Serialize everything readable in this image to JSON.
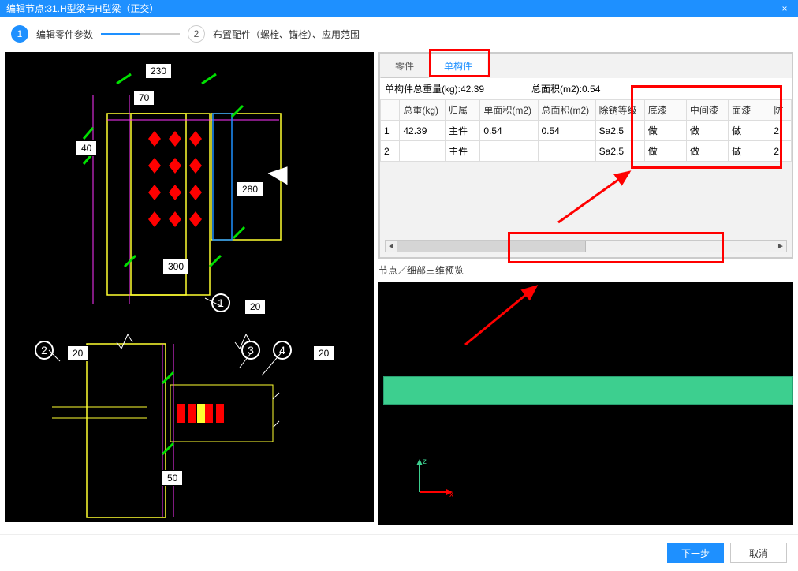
{
  "title": "编辑节点:31.H型梁与H型梁（正交）",
  "close_glyph": "×",
  "steps": {
    "one": "1",
    "one_label": "编辑零件参数",
    "two": "2",
    "two_label": "布置配件（螺栓、锚栓）、应用范围"
  },
  "left": {
    "dim_230": "230",
    "dim_70": "70",
    "dim_40": "40",
    "dim_280": "280",
    "dim_300": "300",
    "dim_20a": "20",
    "dim_20b": "20",
    "dim_20c": "20",
    "dim_50": "50",
    "lbl1": "1",
    "lbl2": "2",
    "lbl3": "3",
    "lbl4": "4"
  },
  "tabs": {
    "part": "零件",
    "single": "单构件"
  },
  "summary": {
    "weight": "单构件总重量(kg):42.39",
    "area": "总面积(m2):0.54"
  },
  "grid": {
    "headers": {
      "idx": "",
      "w": "总重(kg)",
      "belong": "归属",
      "sa": "单面积(m2)",
      "ta": "总面积(m2)",
      "rust": "除锈等级",
      "primer": "底漆",
      "mid": "中间漆",
      "top": "面漆",
      "fire": "防"
    },
    "rows": [
      {
        "idx": "1",
        "w": "42.39",
        "belong": "主件",
        "sa": "0.54",
        "ta": "0.54",
        "rust": "Sa2.5",
        "primer": "做",
        "mid": "做",
        "top": "做",
        "fire": "2."
      },
      {
        "idx": "2",
        "w": "",
        "belong": "主件",
        "sa": "",
        "ta": "",
        "rust": "Sa2.5",
        "primer": "做",
        "mid": "做",
        "top": "做",
        "fire": "2."
      }
    ]
  },
  "scroll": {
    "left": "◄",
    "right": "►"
  },
  "preview_label": "节点／细部三维预览",
  "axis": {
    "z": "z",
    "x": "x"
  },
  "footer": {
    "next": "下一步",
    "cancel": "取消"
  }
}
